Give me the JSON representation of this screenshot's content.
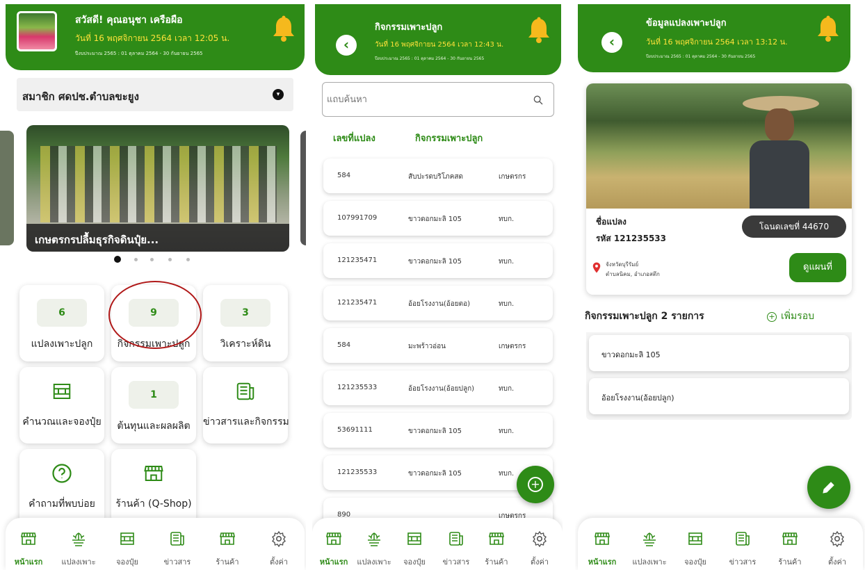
{
  "colors": {
    "brand_green": "#2e8b17",
    "date_yellow": "#ffe23a",
    "highlight_circle": "#b01818"
  },
  "screen1": {
    "greeting": "สวัสดี! คุณอนุชา เครือผือ",
    "date": "วันที่ 16 พฤศจิกายน 2564 เวลา 12:05 น.",
    "budget": "ปีงบประมาณ 2565 : 01 ตุลาคม 2564 - 30 กันยายน 2565",
    "member_dropdown": "สมาชิก ศดปช.ตำบลขะยูง",
    "banner_caption": "เกษตรกรปลื้มธุรกิจดินปุ๋ย...",
    "carousel_dots": 5,
    "carousel_active": 1,
    "tiles": [
      {
        "value": "6",
        "label": "แปลงเพาะปลูก"
      },
      {
        "value": "9",
        "label": "กิจกรรมเพาะปลูก"
      },
      {
        "value": "3",
        "label": "วิเคราะห์ดิน"
      },
      {
        "icon": "calculator-icon",
        "label": "คำนวณและจองปุ๋ย"
      },
      {
        "value": "1",
        "label": "ต้นทุนและผลผลิต"
      },
      {
        "icon": "news-icon",
        "label": "ข่าวสารและกิจกรรม"
      },
      {
        "icon": "question-icon",
        "label": "คำถามที่พบบ่อย"
      },
      {
        "icon": "shop-icon",
        "label": "ร้านค้า (Q-Shop)"
      }
    ]
  },
  "screen2": {
    "title": "กิจกรรมเพาะปลูก",
    "date": "วันที่ 16 พฤศจิกายน 2564 เวลา 12:43 น.",
    "budget": "ปีงบประมาณ 2565 : 01 ตุลาคม 2564 - 30 กันยายน 2565",
    "search_placeholder": "แถบค้นหา",
    "col_plot": "เลขที่แปลง",
    "col_activity": "กิจกรรมเพาะปลูก",
    "rows": [
      {
        "plot": "584",
        "crop": "สับปะรดบริโภคสด",
        "org": "เกษตรกร"
      },
      {
        "plot": "107991709",
        "crop": "ขาวดอกมะลิ 105",
        "org": "ทบก."
      },
      {
        "plot": "121235471",
        "crop": "ขาวดอกมะลิ 105",
        "org": "ทบก."
      },
      {
        "plot": "121235471",
        "crop": "อ้อยโรงงาน(อ้อยตอ)",
        "org": "ทบก."
      },
      {
        "plot": "584",
        "crop": "มะพร้าวอ่อน",
        "org": "เกษตรกร"
      },
      {
        "plot": "121235533",
        "crop": "อ้อยโรงงาน(อ้อยปลูก)",
        "org": "ทบก."
      },
      {
        "plot": "53691111",
        "crop": "ขาวดอกมะลิ 105",
        "org": "ทบก."
      },
      {
        "plot": "121235533",
        "crop": "ขาวดอกมะลิ 105",
        "org": "ทบก."
      },
      {
        "plot": "890",
        "crop": "",
        "org": "เกษตรกร"
      }
    ]
  },
  "screen3": {
    "title": "ข้อมูลแปลงเพาะปลูก",
    "date": "วันที่ 16 พฤศจิกายน 2564 เวลา 13:12 น.",
    "budget": "ปีงบประมาณ 2565 : 01 ตุลาคม 2564 - 30 กันยายน 2565",
    "plot_name_label": "ชื่อแปลง",
    "plot_code": "รหัส 121235533",
    "deed": "โฉนดเลขที่ 44670",
    "province": "จังหวัดบุรีรัมย์",
    "district": "ตำบลนิคม, อำเภอสตึก",
    "map_button": "ดูแผนที่",
    "activity_heading": "กิจกรรมเพาะปลูก 2 รายการ",
    "add_round": "เพิ่มรอบ",
    "activities": [
      "ขาวดอกมะลิ 105",
      "อ้อยโรงงาน(อ้อยปลูก)"
    ]
  },
  "nav": [
    {
      "label": "หน้าแรก",
      "icon": "home-shop-icon"
    },
    {
      "label": "แปลงเพาะ",
      "icon": "plant-icon"
    },
    {
      "label": "จองปุ๋ย",
      "icon": "fertilizer-icon"
    },
    {
      "label": "ข่าวสาร",
      "icon": "news-icon"
    },
    {
      "label": "ร้านค้า",
      "icon": "shop-icon"
    },
    {
      "label": "ตั้งค่า",
      "icon": "gear-icon"
    }
  ]
}
